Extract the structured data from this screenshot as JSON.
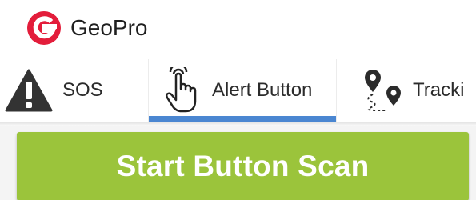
{
  "app": {
    "name": "GeoPro",
    "brand_color": "#e31d3b"
  },
  "tabs": [
    {
      "label": "SOS",
      "icon": "warning-triangle-icon",
      "selected": false
    },
    {
      "label": "Alert Button",
      "icon": "pointing-hand-icon",
      "selected": true
    },
    {
      "label": "Tracki",
      "icon": "route-pins-icon",
      "selected": false
    }
  ],
  "colors": {
    "tab_indicator": "#4a86d1",
    "primary_button": "#9bc43b",
    "text": "#2b2b2b"
  },
  "main": {
    "scan_button_label": "Start Button Scan"
  }
}
